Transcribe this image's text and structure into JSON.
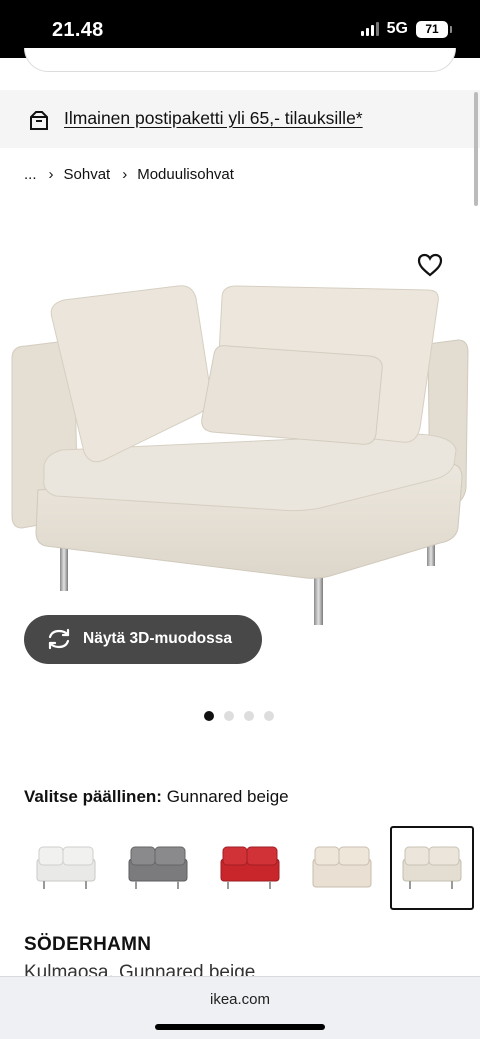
{
  "status_bar": {
    "time": "21.48",
    "network": "5G",
    "battery": "71"
  },
  "promo": {
    "text": "Ilmainen postipaketti yli 65,- tilauksille*",
    "icon": "package-icon"
  },
  "breadcrumb": {
    "items": [
      "...",
      "Sohvat",
      "Moduulisohvat"
    ]
  },
  "product_image": {
    "alt": "SÖDERHAMN",
    "color": "#e6e0d6"
  },
  "favourite": {
    "icon": "heart-icon"
  },
  "view_3d": {
    "label": "Näytä 3D-muodossa",
    "icon": "rotate-3d-icon"
  },
  "carousel": {
    "count": 4,
    "active": 0
  },
  "cover": {
    "label": "Valitse päällinen:",
    "value": "Gunnared beige",
    "swatches": [
      {
        "color": "#e9e9e7",
        "selected": false
      },
      {
        "color": "#7b7b7d",
        "selected": false
      },
      {
        "color": "#c8262b",
        "selected": false
      },
      {
        "color": "#e9dfd2",
        "selected": false
      },
      {
        "color": "#e3ddd2",
        "selected": true
      }
    ]
  },
  "product": {
    "name": "SÖDERHAMN",
    "description": "Kulmaosa, Gunnared beige"
  },
  "browser": {
    "url": "ikea.com"
  }
}
